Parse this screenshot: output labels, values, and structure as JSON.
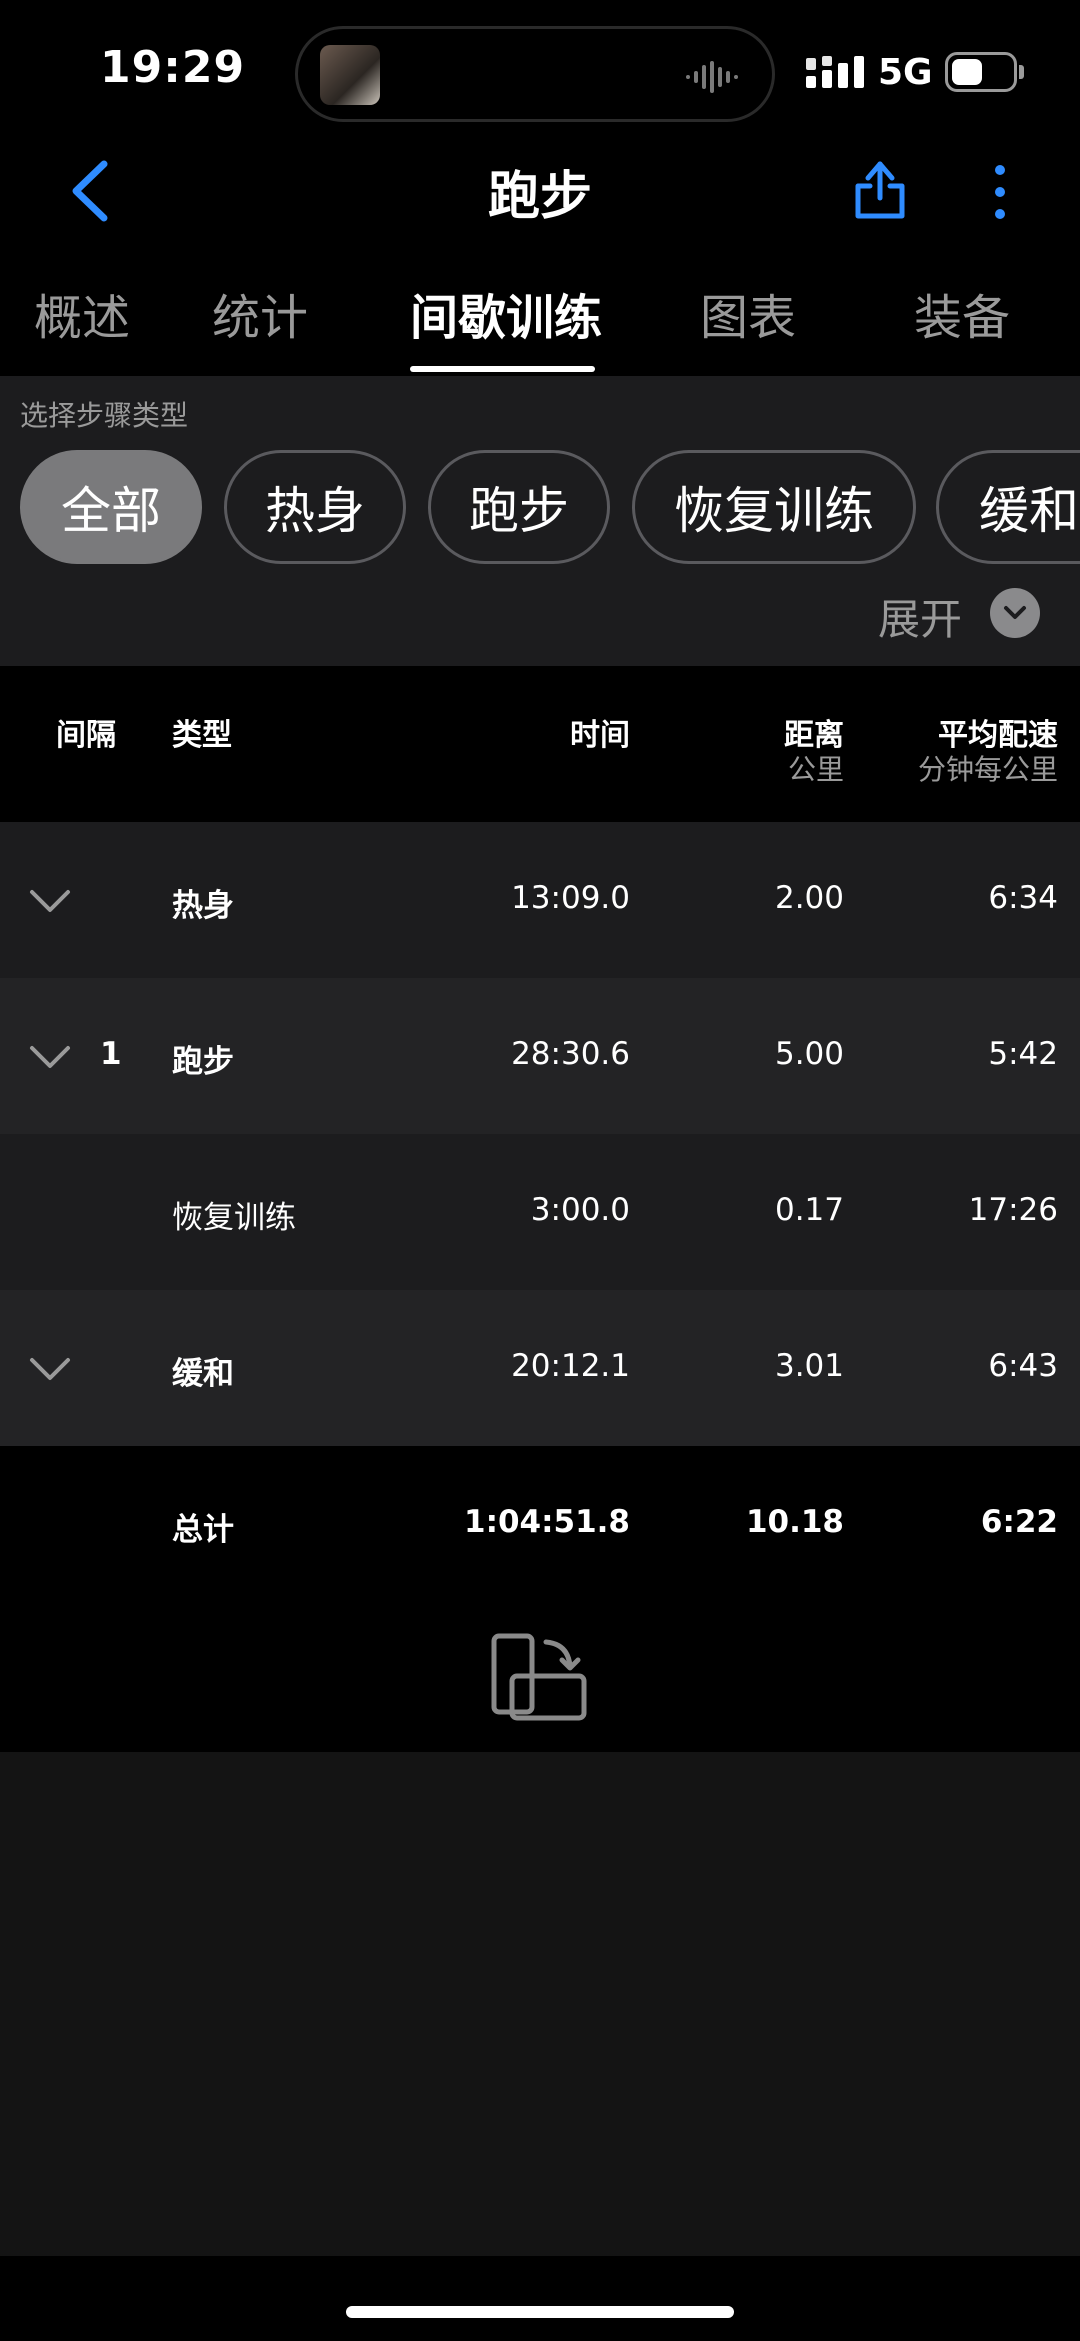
{
  "status": {
    "time": "19:29",
    "network": "5G"
  },
  "header": {
    "title": "跑步",
    "back_icon": "chevron-left-icon",
    "share_icon": "share-icon",
    "more_icon": "more-vertical-icon",
    "accent": "#2f8cff"
  },
  "tabs": [
    {
      "label": "概述"
    },
    {
      "label": "统计"
    },
    {
      "label": "间歇训练",
      "active": true
    },
    {
      "label": "图表"
    },
    {
      "label": "装备"
    }
  ],
  "filter": {
    "label": "选择步骤类型",
    "chips": [
      {
        "label": "全部",
        "selected": true
      },
      {
        "label": "热身"
      },
      {
        "label": "跑步"
      },
      {
        "label": "恢复训练"
      },
      {
        "label": "缓和"
      }
    ],
    "expand_label": "展开"
  },
  "table": {
    "headers": {
      "interval": "间隔",
      "type": "类型",
      "time": "时间",
      "distance": "距离",
      "distance_unit": "公里",
      "pace": "平均配速",
      "pace_unit": "分钟每公里"
    },
    "rows": [
      {
        "interval": "",
        "type": "热身",
        "time": "13:09.0",
        "distance": "2.00",
        "pace": "6:34",
        "expandable": true
      },
      {
        "interval": "1",
        "type": "跑步",
        "time": "28:30.6",
        "distance": "5.00",
        "pace": "5:42",
        "expandable": true
      },
      {
        "interval": "",
        "type": "恢复训练",
        "time": "3:00.0",
        "distance": "0.17",
        "pace": "17:26",
        "expandable": false
      },
      {
        "interval": "",
        "type": "缓和",
        "time": "20:12.1",
        "distance": "3.01",
        "pace": "6:43",
        "expandable": true
      }
    ],
    "total": {
      "type": "总计",
      "time": "1:04:51.8",
      "distance": "10.18",
      "pace": "6:22"
    }
  },
  "rotate_icon": "rotate-device-icon"
}
